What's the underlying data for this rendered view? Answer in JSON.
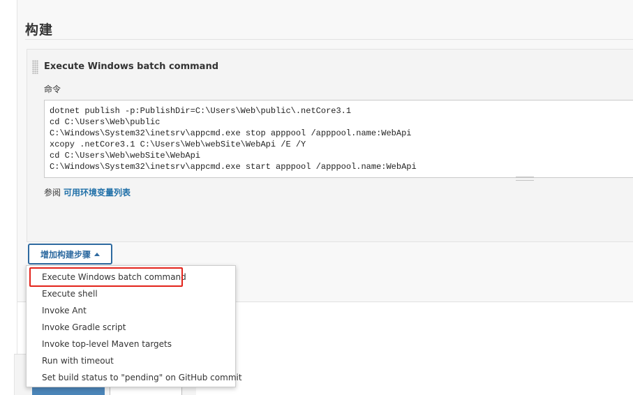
{
  "section": {
    "title": "构建"
  },
  "build_step": {
    "title": "Execute Windows batch command",
    "command_label": "命令",
    "command_lines": [
      "dotnet publish -p:PublishDir=C:\\Users\\Web\\public\\.netCore3.1",
      "cd C:\\Users\\Web\\public",
      "C:\\Windows\\System32\\inetsrv\\appcmd.exe stop apppool /apppool.name:WebApi",
      "xcopy .netCore3.1 C:\\Users\\Web\\webSite\\WebApi /E /Y",
      "cd C:\\Users\\Web\\webSite\\WebApi",
      "C:\\Windows\\System32\\inetsrv\\appcmd.exe start apppool /apppool.name:WebApi"
    ],
    "see_text": "参阅",
    "env_link": "可用环境变量列表"
  },
  "add_step": {
    "label": "增加构建步骤"
  },
  "dropdown": {
    "items": [
      "Execute Windows batch command",
      "Execute shell",
      "Invoke Ant",
      "Invoke Gradle script",
      "Invoke top-level Maven targets",
      "Run with timeout",
      "Set build status to \"pending\" on GitHub commit"
    ],
    "highlighted_item": "Execute Windows batch command"
  },
  "colors": {
    "link": "#1f6fa8",
    "button_border": "#2e6aa0",
    "highlight": "#e2231a",
    "save_button": "#4b85b8"
  },
  "icons": [
    "drag-handle-icon",
    "caret-up-icon"
  ]
}
